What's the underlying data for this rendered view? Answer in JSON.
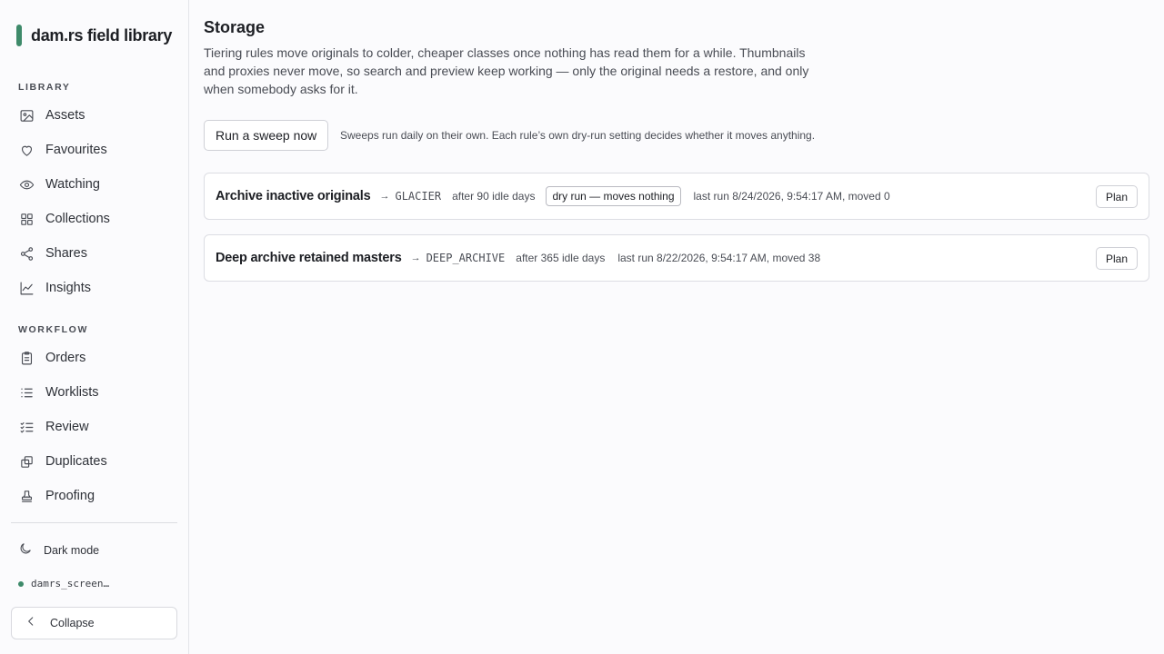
{
  "brand": {
    "name": "dam.rs field library",
    "accent": "#3e8a6a"
  },
  "sidebar": {
    "sections": [
      {
        "label": "LIBRARY",
        "items": [
          {
            "label": "Assets",
            "icon": "image-icon"
          },
          {
            "label": "Favourites",
            "icon": "heart-icon"
          },
          {
            "label": "Watching",
            "icon": "eye-icon"
          },
          {
            "label": "Collections",
            "icon": "grid-icon"
          },
          {
            "label": "Shares",
            "icon": "share-icon"
          },
          {
            "label": "Insights",
            "icon": "chart-line-icon"
          }
        ]
      },
      {
        "label": "WORKFLOW",
        "items": [
          {
            "label": "Orders",
            "icon": "clipboard-icon"
          },
          {
            "label": "Worklists",
            "icon": "list-icon"
          },
          {
            "label": "Review",
            "icon": "checklist-icon"
          },
          {
            "label": "Duplicates",
            "icon": "copy-icon"
          },
          {
            "label": "Proofing",
            "icon": "stamp-icon"
          }
        ]
      }
    ],
    "dark_mode_label": "Dark mode",
    "user": "damrs_screen…",
    "collapse_label": "Collapse"
  },
  "page": {
    "title": "Storage",
    "description": "Tiering rules move originals to colder, cheaper classes once nothing has read them for a while. Thumbnails and proxies never move, so search and preview keep working — only the original needs a restore, and only when somebody asks for it.",
    "sweep_button": "Run a sweep now",
    "sweep_note": "Sweeps run daily on their own. Each rule’s own dry-run setting decides whether it moves anything."
  },
  "rules": [
    {
      "name": "Archive inactive originals",
      "arrow": "→",
      "target": "GLACIER",
      "idle": "after 90 idle days",
      "dry_run_badge": "dry run — moves nothing",
      "last_run": "last run 8/24/2026, 9:54:17 AM, moved 0",
      "plan_label": "Plan"
    },
    {
      "name": "Deep archive retained masters",
      "arrow": "→",
      "target": "DEEP_ARCHIVE",
      "idle": "after 365 idle days",
      "dry_run_badge": "",
      "last_run": "last run 8/22/2026, 9:54:17 AM, moved 38",
      "plan_label": "Plan"
    }
  ]
}
